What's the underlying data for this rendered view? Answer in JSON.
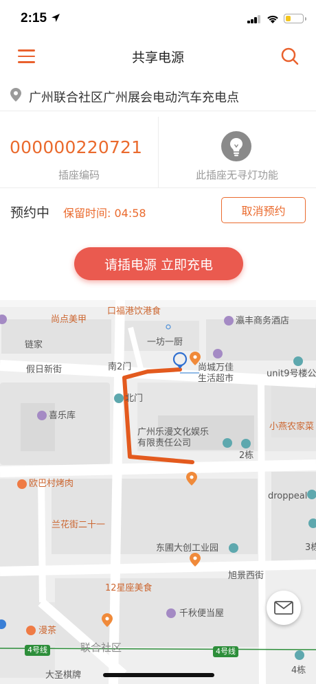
{
  "status_bar": {
    "time": "2:15",
    "location_icon": "location-arrow-icon",
    "battery_color": "#f3c51e",
    "battery_level": 0.3
  },
  "nav": {
    "title": "共享电源",
    "menu_icon": "hamburger-menu-icon",
    "search_icon": "search-icon",
    "accent": "#e9612d"
  },
  "location": {
    "icon": "map-pin-icon",
    "text": "广州联合社区广州展会电动汽车充电点"
  },
  "socket": {
    "code": "000000220721",
    "code_label": "插座编码",
    "light_icon": "light-bulb-icon",
    "light_label": "此插座无寻灯功能"
  },
  "reservation": {
    "status": "预约中",
    "time_label": "保留时间: 04:58",
    "cancel_label": "取消预约"
  },
  "charge_button": {
    "label": "请插电源 立即充电",
    "color": "#ea5a4f"
  },
  "map": {
    "labels": {
      "fuguang": "口福港饮港食",
      "shangdian": "尚点美甲",
      "yingfeng": "瀛丰商务酒店",
      "lianjia": "链家",
      "yifang": "一坊一厨",
      "jiari": "假日新街",
      "nan2men": "南2门",
      "shangcheng": "尚城万佳\n生活超市",
      "unit9": "unit9号楼公",
      "xileku": "喜乐库",
      "beimen": "北门",
      "leman": "广州乐漫文化娱乐\n有限责任公司",
      "xiaoyan": "小燕农家菜",
      "dong2": "2栋",
      "oubacun": "欧巴村烤肉",
      "droppeal": "droppeal",
      "lanhua": "兰花街二十一",
      "dongpu": "东圃大创工业园",
      "dong3": "3栋",
      "xujing": "旭景西街",
      "xingzuo": "12星座美食",
      "qianqiu": "千秋便当屋",
      "mancha": "漫茶",
      "lianhe": "联合社区",
      "line4a": "4号线",
      "line4b": "4号线",
      "dong4": "4栋",
      "dasheng": "大圣棋牌"
    },
    "route_color": "#e35a1e",
    "mail_icon": "mail-icon"
  }
}
